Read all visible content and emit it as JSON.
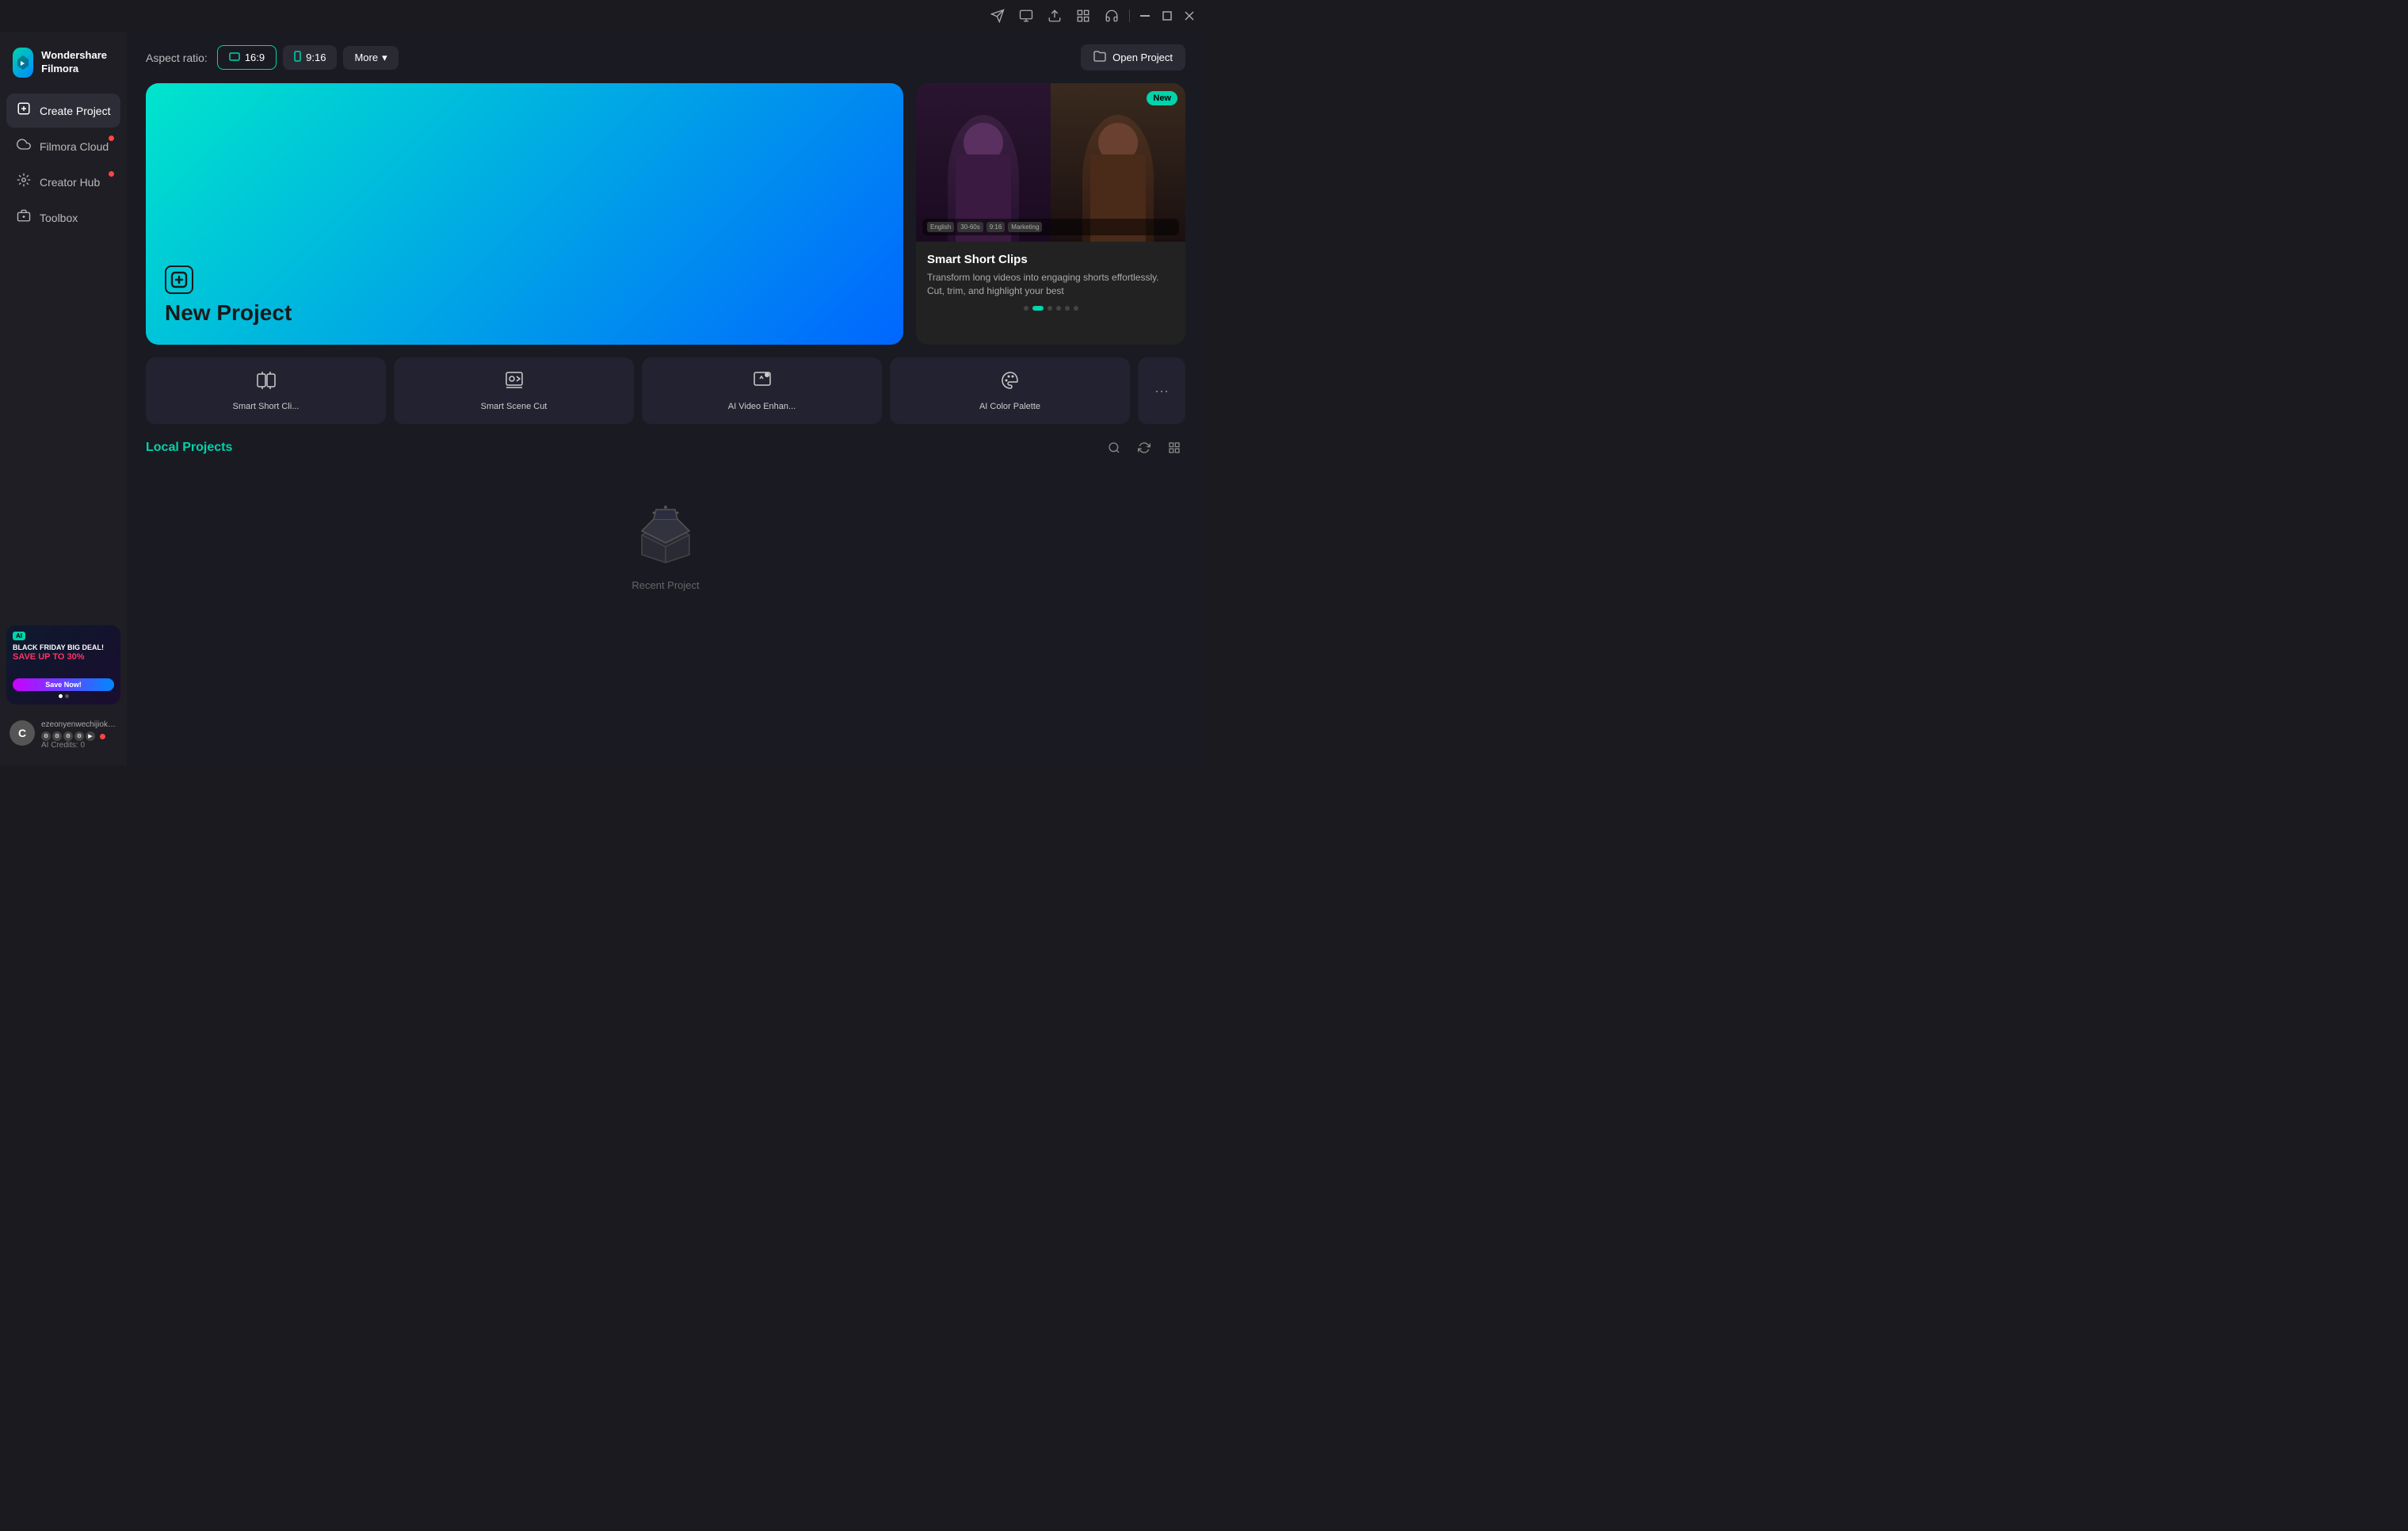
{
  "app": {
    "name": "Wondershare Filmora",
    "logo_letter": "F"
  },
  "titlebar": {
    "icons": [
      "share-icon",
      "monitor-icon",
      "upload-icon",
      "grid-icon",
      "headset-icon"
    ],
    "window_controls": [
      "minimize-icon",
      "maximize-icon",
      "close-icon"
    ]
  },
  "sidebar": {
    "nav_items": [
      {
        "id": "create-project",
        "label": "Create Project",
        "icon": "➕",
        "active": true,
        "dot": false
      },
      {
        "id": "filmora-cloud",
        "label": "Filmora Cloud",
        "icon": "☁",
        "active": false,
        "dot": true
      },
      {
        "id": "creator-hub",
        "label": "Creator Hub",
        "icon": "💡",
        "active": false,
        "dot": true
      },
      {
        "id": "toolbox",
        "label": "Toolbox",
        "icon": "🧰",
        "active": false,
        "dot": false
      }
    ],
    "ad": {
      "badge": "AI",
      "line1": "BLACK FRIDAY BIG DEAL!",
      "line2": "SAVE UP TO 30%",
      "save_btn": "Save Now!",
      "dots": [
        true,
        false
      ]
    },
    "user": {
      "avatar": "C",
      "email": "ezeonyenwechijioke@gmai...",
      "credits_label": "AI Credits: 0"
    }
  },
  "toolbar": {
    "aspect_label": "Aspect ratio:",
    "aspect_options": [
      {
        "label": "16:9",
        "active": true
      },
      {
        "label": "9:16",
        "active": false
      }
    ],
    "more_label": "More",
    "open_project_label": "Open Project"
  },
  "new_project": {
    "title": "New Project",
    "icon": "+"
  },
  "featured": {
    "badge": "New",
    "title": "Smart Short Clips",
    "description": "Transform long videos into engaging shorts effortlessly. Cut, trim, and highlight your best",
    "dots": [
      false,
      true,
      false,
      false,
      false,
      false
    ]
  },
  "quick_tools": [
    {
      "id": "smart-short-clips",
      "label": "Smart Short Cli...",
      "icon_type": "split-screen"
    },
    {
      "id": "smart-scene-cut",
      "label": "Smart Scene Cut",
      "icon_type": "camera-plus"
    },
    {
      "id": "ai-video-enhance",
      "label": "AI Video Enhan...",
      "icon_type": "sparkle-camera"
    },
    {
      "id": "ai-color-palette",
      "label": "AI Color Palette",
      "icon_type": "palette"
    },
    {
      "id": "more-tools",
      "label": "...",
      "icon_type": "more"
    }
  ],
  "local_projects": {
    "title": "Local Projects",
    "empty_state_text": "Recent Project",
    "actions": [
      "search-icon",
      "refresh-icon",
      "list-view-icon"
    ]
  }
}
